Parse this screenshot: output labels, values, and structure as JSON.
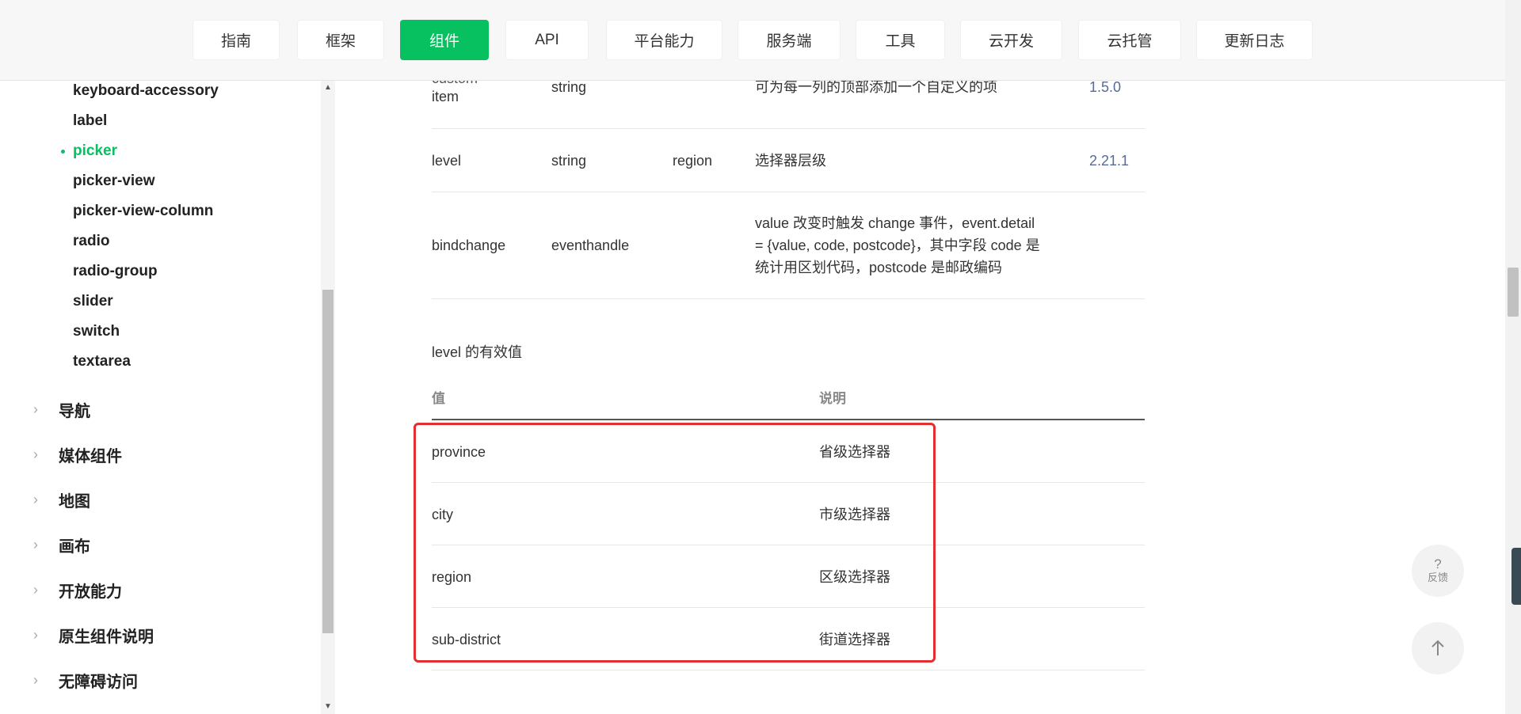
{
  "nav": {
    "items": [
      {
        "label": "指南",
        "active": false
      },
      {
        "label": "框架",
        "active": false
      },
      {
        "label": "组件",
        "active": true
      },
      {
        "label": "API",
        "active": false
      },
      {
        "label": "平台能力",
        "active": false
      },
      {
        "label": "服务端",
        "active": false
      },
      {
        "label": "工具",
        "active": false
      },
      {
        "label": "云开发",
        "active": false
      },
      {
        "label": "云托管",
        "active": false
      },
      {
        "label": "更新日志",
        "active": false
      }
    ],
    "active_color": "#07c160"
  },
  "sidebar": {
    "sub_items": [
      {
        "label": "keyboard-accessory",
        "active": false
      },
      {
        "label": "label",
        "active": false
      },
      {
        "label": "picker",
        "active": true
      },
      {
        "label": "picker-view",
        "active": false
      },
      {
        "label": "picker-view-column",
        "active": false
      },
      {
        "label": "radio",
        "active": false
      },
      {
        "label": "radio-group",
        "active": false
      },
      {
        "label": "slider",
        "active": false
      },
      {
        "label": "switch",
        "active": false
      },
      {
        "label": "textarea",
        "active": false
      }
    ],
    "groups": [
      {
        "label": "导航",
        "icon": "chevron-right-icon"
      },
      {
        "label": "媒体组件",
        "icon": "chevron-right-icon"
      },
      {
        "label": "地图",
        "icon": "chevron-right-icon"
      },
      {
        "label": "画布",
        "icon": "chevron-right-icon"
      },
      {
        "label": "开放能力",
        "icon": "chevron-right-icon"
      },
      {
        "label": "原生组件说明",
        "icon": "chevron-right-icon"
      },
      {
        "label": "无障碍访问",
        "icon": "chevron-right-icon"
      }
    ]
  },
  "attr_table": {
    "rows": [
      {
        "name_lines": [
          "custom-",
          "item"
        ],
        "type": "string",
        "default": "",
        "desc_lines": [
          "可为每一列的顶部添加一个自定义的项"
        ],
        "version": "1.5.0"
      },
      {
        "name_lines": [
          "level"
        ],
        "type": "string",
        "default": "region",
        "desc_lines": [
          "选择器层级"
        ],
        "version": "2.21.1"
      },
      {
        "name_lines": [
          "bindchange"
        ],
        "type": "eventhandle",
        "default": "",
        "desc_lines": [
          "value 改变时触发 change 事件，event.detail",
          "= {value, code, postcode}，其中字段 code 是",
          "统计用区划代码，postcode 是邮政编码"
        ],
        "version": ""
      }
    ]
  },
  "level_section": {
    "title": "level 的有效值",
    "headers": {
      "value": "值",
      "desc": "说明"
    },
    "rows": [
      {
        "value": "province",
        "desc": "省级选择器"
      },
      {
        "value": "city",
        "desc": "市级选择器"
      },
      {
        "value": "region",
        "desc": "区级选择器"
      },
      {
        "value": "sub-district",
        "desc": "街道选择器"
      }
    ],
    "highlight_color": "#e22f2f"
  },
  "floating": {
    "feedback_icon": "?",
    "feedback_label": "反馈",
    "top_icon": "arrow-up-icon"
  }
}
